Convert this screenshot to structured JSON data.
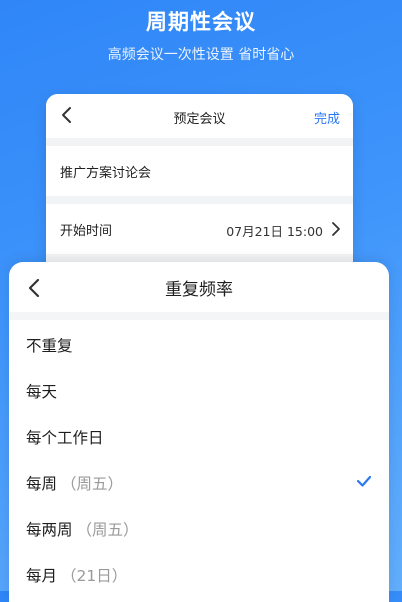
{
  "hero": {
    "title": "周期性会议",
    "subtitle": "高频会议一次性设置 省时省心"
  },
  "booking": {
    "title": "预定会议",
    "done_label": "完成",
    "meeting_name": "推广方案讨论会",
    "start_label": "开始时间",
    "start_value": "07月21日 15:00"
  },
  "repeat_sheet": {
    "title": "重复频率",
    "options": [
      {
        "label": "不重复",
        "detail": "",
        "selected": false
      },
      {
        "label": "每天",
        "detail": "",
        "selected": false
      },
      {
        "label": "每个工作日",
        "detail": "",
        "selected": false
      },
      {
        "label": "每周",
        "detail": "（周五）",
        "selected": true
      },
      {
        "label": "每两周",
        "detail": "（周五）",
        "selected": false
      },
      {
        "label": "每月",
        "detail": "（21日）",
        "selected": false
      }
    ]
  },
  "colors": {
    "accent": "#2a78f0",
    "background": "#3f95fb"
  },
  "icons": {
    "back": "chevron-left-icon",
    "forward": "chevron-right-icon",
    "check": "checkmark-icon"
  }
}
